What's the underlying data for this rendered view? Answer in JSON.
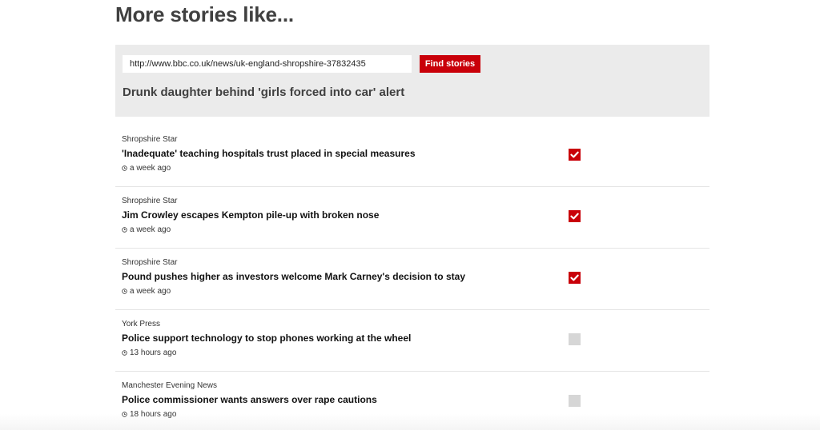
{
  "page": {
    "title": "More stories like..."
  },
  "search": {
    "url_value": "http://www.bbc.co.uk/news/uk-england-shropshire-37832435",
    "button_label": "Find stories",
    "source_headline": "Drunk daughter behind 'girls forced into car' alert"
  },
  "stories": [
    {
      "publisher": "Shropshire Star",
      "headline": "'Inadequate' teaching hospitals trust placed in special measures",
      "time": "a week ago",
      "checked": true
    },
    {
      "publisher": "Shropshire Star",
      "headline": "Jim Crowley escapes Kempton pile-up with broken nose",
      "time": "a week ago",
      "checked": true
    },
    {
      "publisher": "Shropshire Star",
      "headline": "Pound pushes higher as investors welcome Mark Carney's decision to stay",
      "time": "a week ago",
      "checked": true
    },
    {
      "publisher": "York Press",
      "headline": "Police support technology to stop phones working at the wheel",
      "time": "13 hours ago",
      "checked": false
    },
    {
      "publisher": "Manchester Evening News",
      "headline": "Police commissioner wants answers over rape cautions",
      "time": "18 hours ago",
      "checked": false
    }
  ],
  "icons": {
    "time": "clock-icon",
    "checkbox_checked": "check-icon"
  },
  "colors": {
    "accent": "#c90009",
    "panel_background": "#ebebeb",
    "checkbox_unchecked": "#d6d6d6",
    "title_text": "#404040"
  }
}
